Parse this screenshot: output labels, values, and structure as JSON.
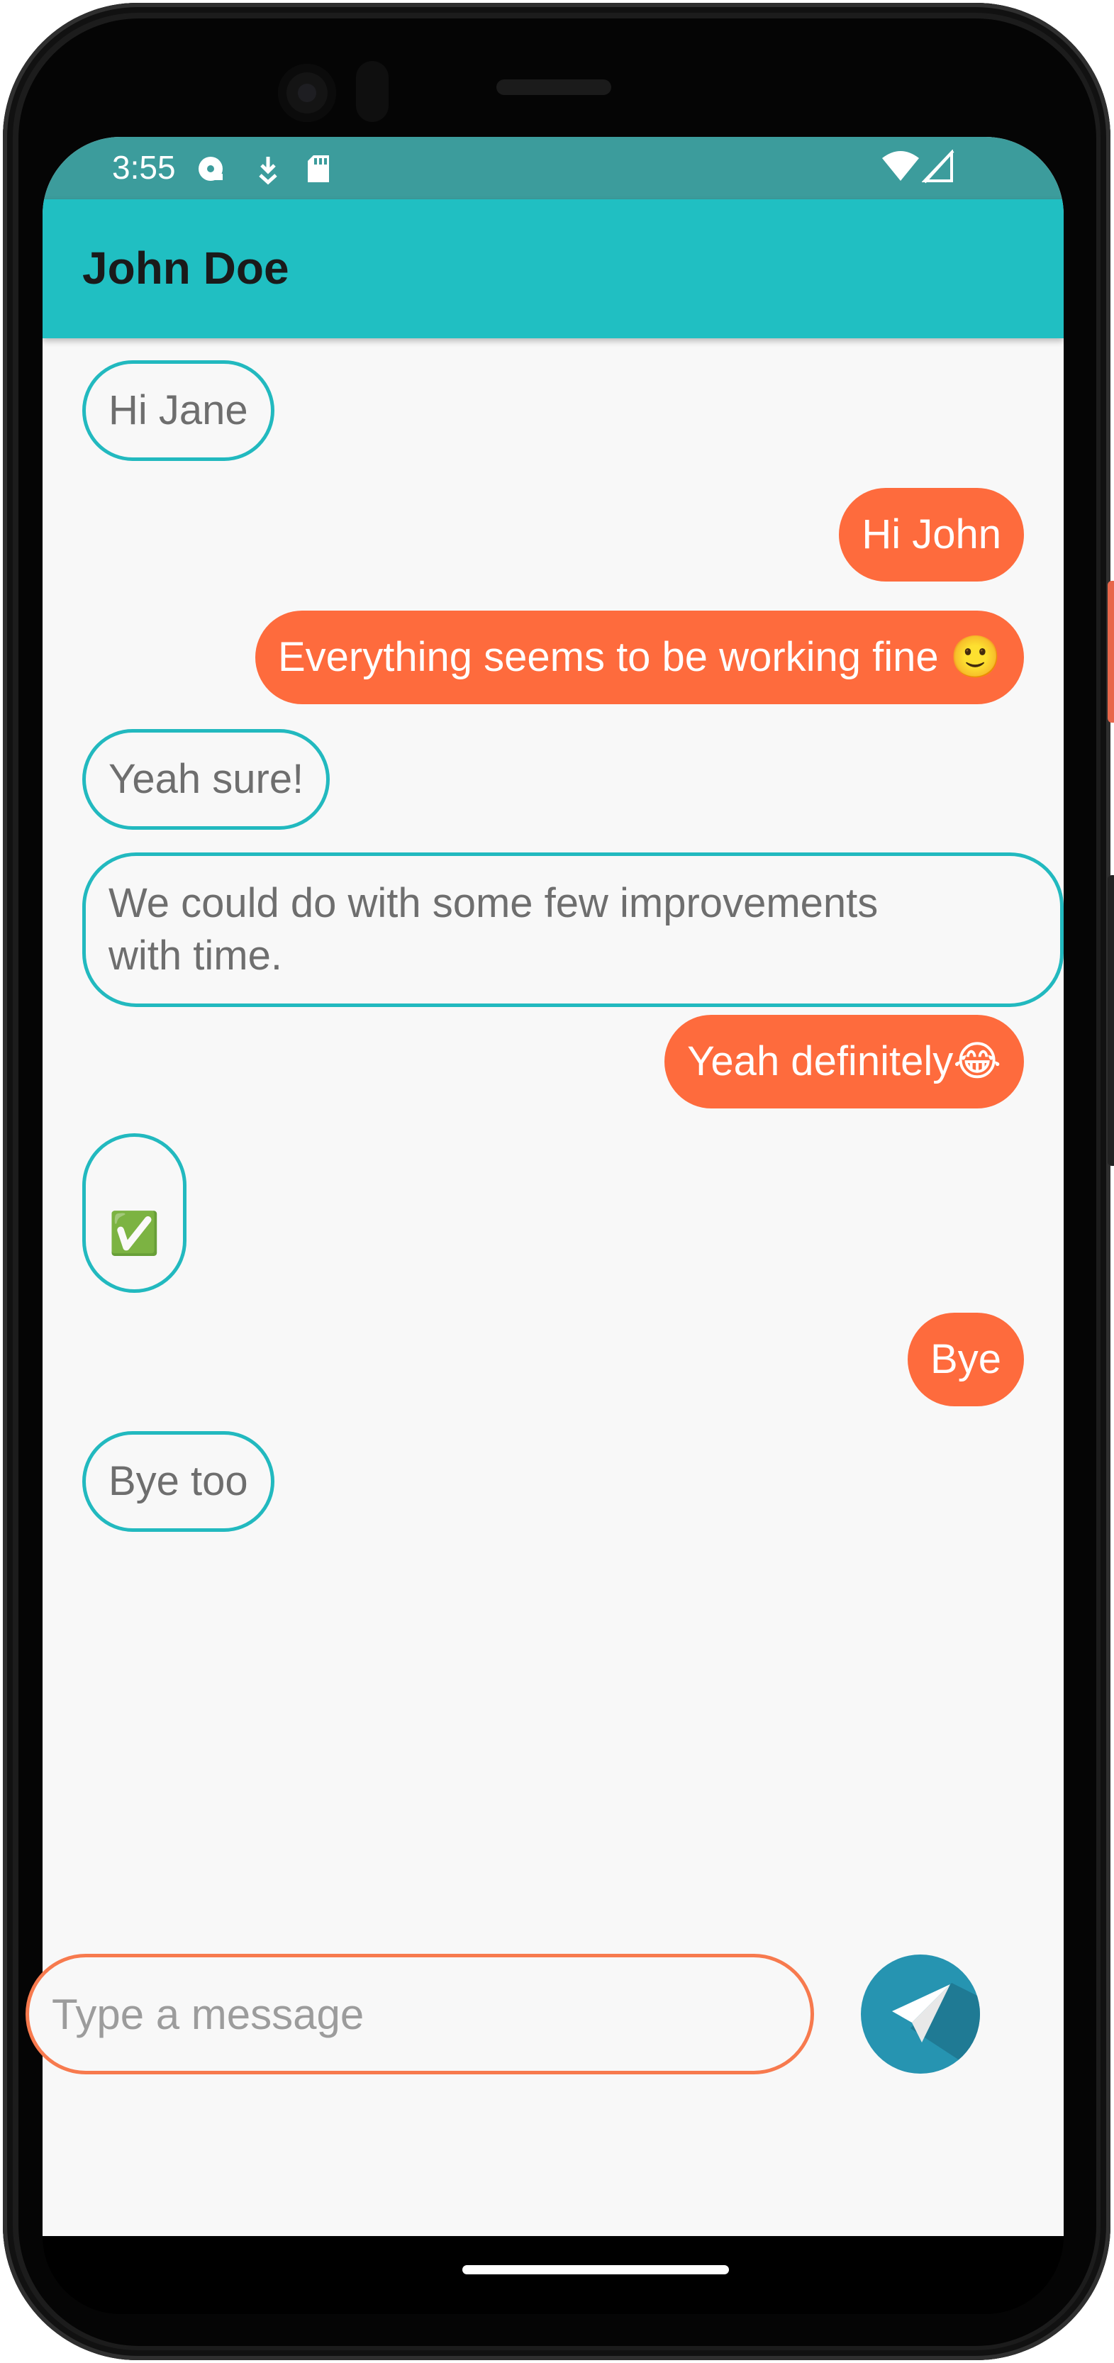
{
  "status_bar": {
    "time": "3:55",
    "left_icons": [
      "media-icon",
      "download-icon",
      "sd-card-icon"
    ],
    "right_icons": [
      "wifi-icon",
      "signal-icon"
    ]
  },
  "app_bar": {
    "title": "John Doe"
  },
  "messages": [
    {
      "direction": "incoming",
      "text": "Hi Jane"
    },
    {
      "direction": "outgoing",
      "text": "Hi John"
    },
    {
      "direction": "outgoing",
      "text": "Everything seems to be working fine 🙂"
    },
    {
      "direction": "incoming",
      "text": "Yeah sure!"
    },
    {
      "direction": "incoming",
      "text": "We could do with some few improvements\nwith time."
    },
    {
      "direction": "outgoing",
      "text": "Yeah definitely😂"
    },
    {
      "direction": "incoming",
      "text": "\n✅"
    },
    {
      "direction": "outgoing",
      "text": "Bye"
    },
    {
      "direction": "incoming",
      "text": "Bye too"
    }
  ],
  "composer": {
    "placeholder": "Type a message",
    "value": "",
    "send_icon": "send-icon"
  },
  "colors": {
    "status_bar": "#3c9c9c",
    "app_bar": "#20bfc2",
    "incoming_border": "#22b9bf",
    "outgoing_bubble": "#fe6b3d",
    "composer_border": "#f77a4e",
    "send_button": "#2694b1"
  }
}
